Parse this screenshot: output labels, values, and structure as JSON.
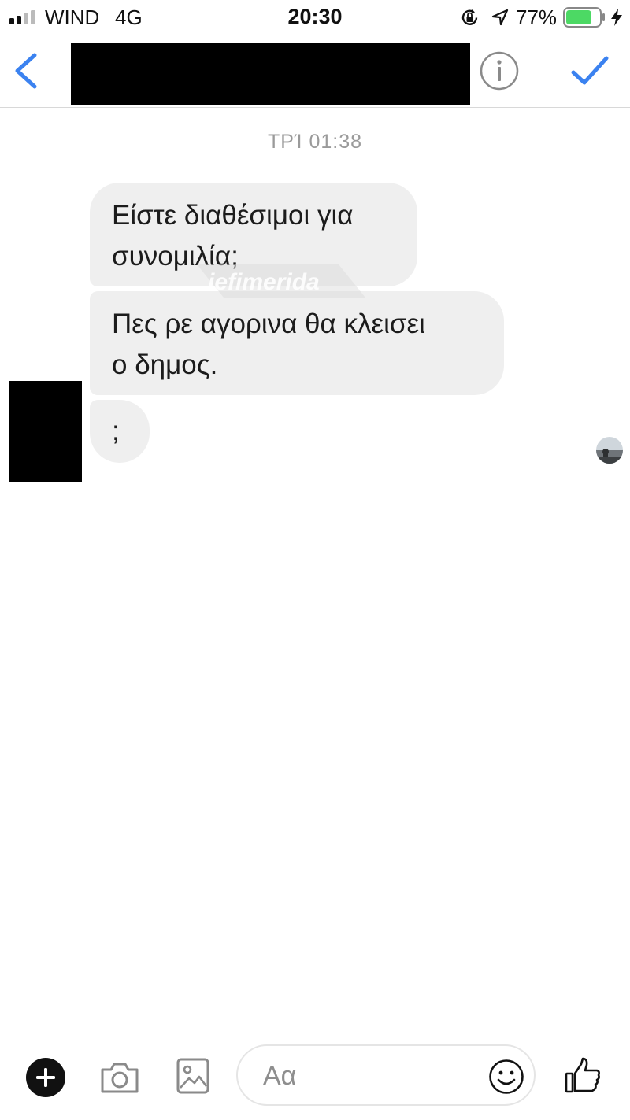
{
  "status_bar": {
    "carrier": "WIND",
    "network": "4G",
    "time": "20:30",
    "battery_percent": "77%",
    "battery_level": 0.77,
    "icons": [
      "signal-icon",
      "rotation-lock-icon",
      "location-arrow-icon",
      "battery-icon",
      "charging-bolt-icon"
    ]
  },
  "header": {
    "icons": [
      "back-chevron-icon",
      "info-icon",
      "checkmark-icon"
    ],
    "accent_color": "#3b82f0"
  },
  "conversation": {
    "timestamp": "ΤΡΊ 01:38",
    "messages": [
      {
        "text_line1": "Είστε διαθέσιμοι για",
        "text_line2": "συνομιλία;"
      },
      {
        "text_line1": "Πες ρε αγορινα θα κλεισει",
        "text_line2": "ο δημος."
      },
      {
        "text_line1": ";"
      }
    ],
    "watermark": "iefimerida"
  },
  "composer": {
    "placeholder": "Αα",
    "icons": [
      "plus-icon",
      "camera-icon",
      "gallery-icon",
      "emoji-icon",
      "thumbs-up-icon"
    ]
  }
}
